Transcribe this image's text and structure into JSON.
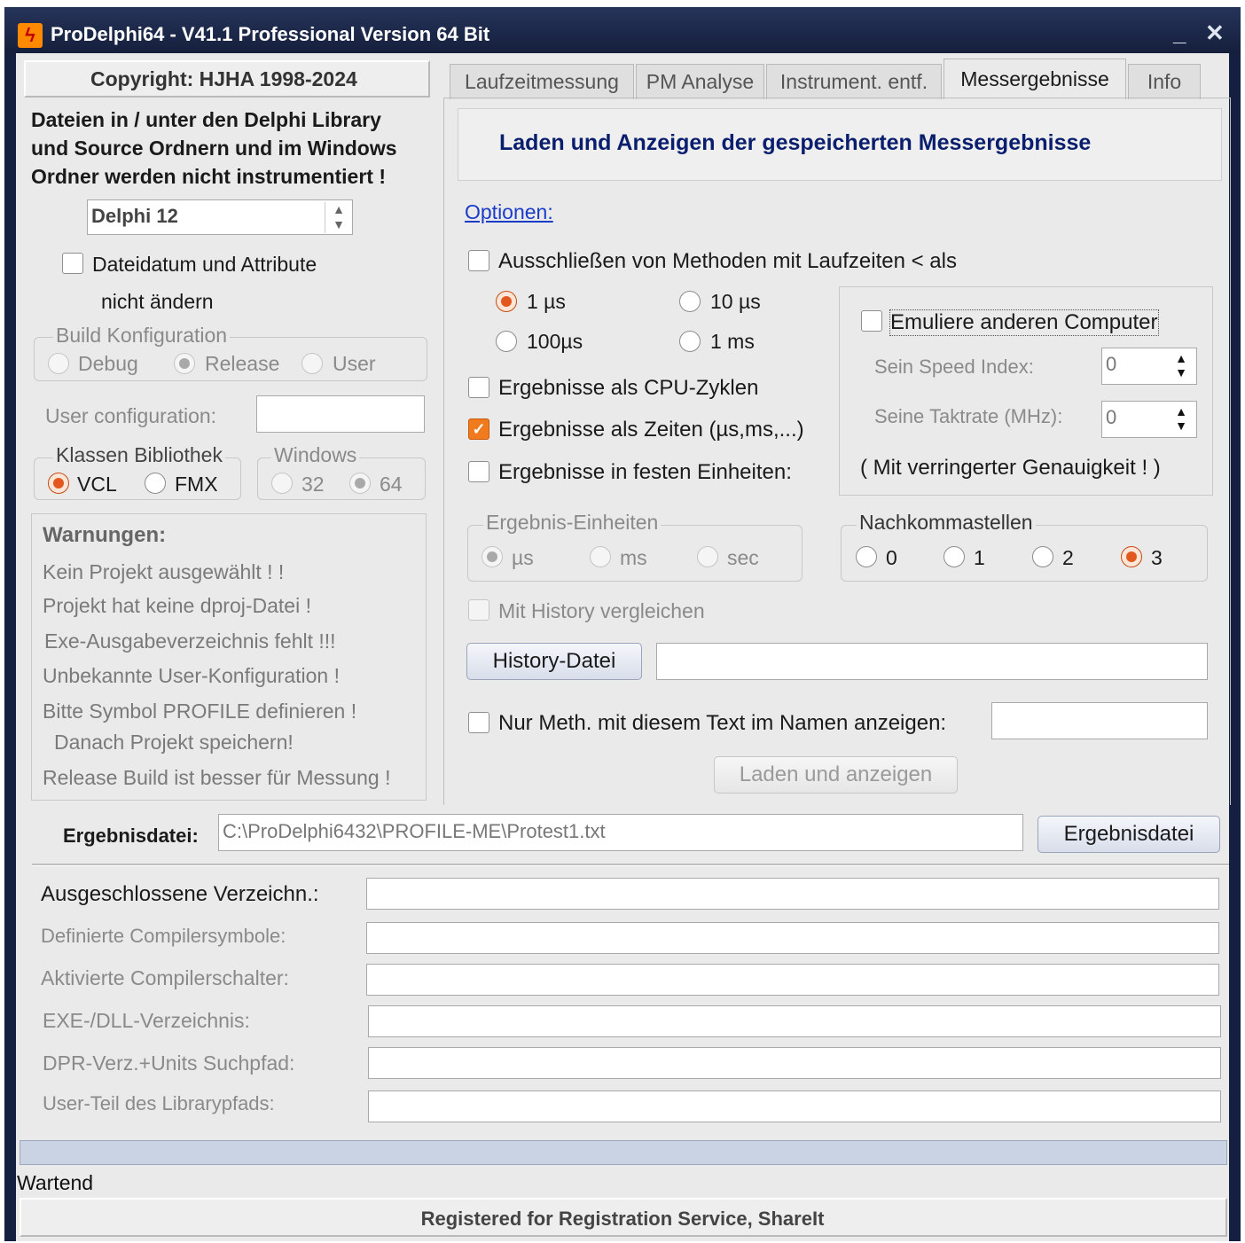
{
  "window": {
    "title": "ProDelphi64 - V41.1  Professional Version 64 Bit",
    "minimize": "_",
    "close": "✕",
    "icon": "lightning-bolt-icon"
  },
  "left": {
    "copyright": "Copyright: HJHA 1998-2024",
    "notice_line1": "Dateien in / unter den Delphi Library",
    "notice_line2": "und Source Ordnern und im Windows",
    "notice_line3": "Ordner werden nicht instrumentiert !",
    "delphi_version": "Delphi 12",
    "keep_date_label1": "Dateidatum und Attribute",
    "keep_date_label2": "nicht ändern",
    "build_config": {
      "title": "Build Konfiguration",
      "options": [
        "Debug",
        "Release",
        "User"
      ],
      "selected": "Release"
    },
    "user_config_label": "User configuration:",
    "user_config_value": "",
    "class_lib": {
      "title": "Klassen Bibliothek",
      "options": [
        "VCL",
        "FMX"
      ],
      "selected": "VCL"
    },
    "windows": {
      "title": "Windows",
      "options": [
        "32",
        "64"
      ],
      "selected": "64"
    },
    "warnings": {
      "title": "Warnungen:",
      "items": [
        "Kein Projekt ausgewählt ! !",
        "Projekt hat keine dproj-Datei !",
        "Exe-Ausgabeverzeichnis fehlt !!!",
        "Unbekannte User-Konfiguration !",
        "Bitte Symbol PROFILE definieren !",
        "Danach Projekt speichern!",
        "Release Build ist besser für Messung !"
      ]
    }
  },
  "tabs": [
    {
      "label": "Laufzeitmessung",
      "active": false
    },
    {
      "label": "PM Analyse",
      "active": false
    },
    {
      "label": "Instrument. entf.",
      "active": false
    },
    {
      "label": "Messergebnisse",
      "active": true
    },
    {
      "label": "Info",
      "active": false
    }
  ],
  "results": {
    "heading": "Laden und Anzeigen der gespeicherten Messergebnisse",
    "options_link": "Optionen:",
    "exclude_label": "Ausschließen von Methoden mit Laufzeiten < als",
    "thresholds": [
      "1 µs",
      "10 µs",
      "100µs",
      "1 ms"
    ],
    "threshold_selected": "1 µs",
    "cpu_cycles_label": "Ergebnisse als CPU-Zyklen",
    "as_times_label": "Ergebnisse als Zeiten (µs,ms,...)",
    "fixed_units_label": "Ergebnisse in festen Einheiten:",
    "emulate_label": "Emuliere anderen Computer",
    "speed_index_label": "Sein Speed Index:",
    "speed_index_value": "0",
    "clock_rate_label": "Seine Taktrate (MHz):",
    "clock_rate_value": "0",
    "accuracy_note": "( Mit verringerter Genauigkeit ! )",
    "units_group": {
      "title": "Ergebnis-Einheiten",
      "options": [
        "µs",
        "ms",
        "sec"
      ],
      "selected": "µs"
    },
    "decimals_group": {
      "title": "Nachkommastellen",
      "options": [
        "0",
        "1",
        "2",
        "3"
      ],
      "selected": "3"
    },
    "history_compare_label": "Mit History vergleichen",
    "history_button": "History-Datei",
    "history_path": "",
    "name_filter_label": "Nur Meth. mit diesem Text im Namen anzeigen:",
    "name_filter_value": "",
    "load_button": "Laden und anzeigen"
  },
  "result_file": {
    "label": "Ergebnisdatei:",
    "path": "C:\\ProDelphi6432\\PROFILE-ME\\Protest1.txt",
    "button": "Ergebnisdatei"
  },
  "paths": [
    {
      "label": "Ausgeschlossene Verzeichn.:",
      "value": ""
    },
    {
      "label": "Definierte Compilersymbole:",
      "value": ""
    },
    {
      "label": "Aktivierte Compilerschalter:",
      "value": ""
    },
    {
      "label": "EXE-/DLL-Verzeichnis:",
      "value": ""
    },
    {
      "label": "DPR-Verz.+Units Suchpfad:",
      "value": ""
    },
    {
      "label": "User-Teil des Librarypfads:",
      "value": ""
    }
  ],
  "status": "Wartend",
  "registration": "Registered for Registration Service, ShareIt",
  "colors": {
    "title_bar": "#1b2645",
    "accent": "#e2581e",
    "heading_text": "#0a1e6e",
    "link": "#1a3cc8"
  }
}
